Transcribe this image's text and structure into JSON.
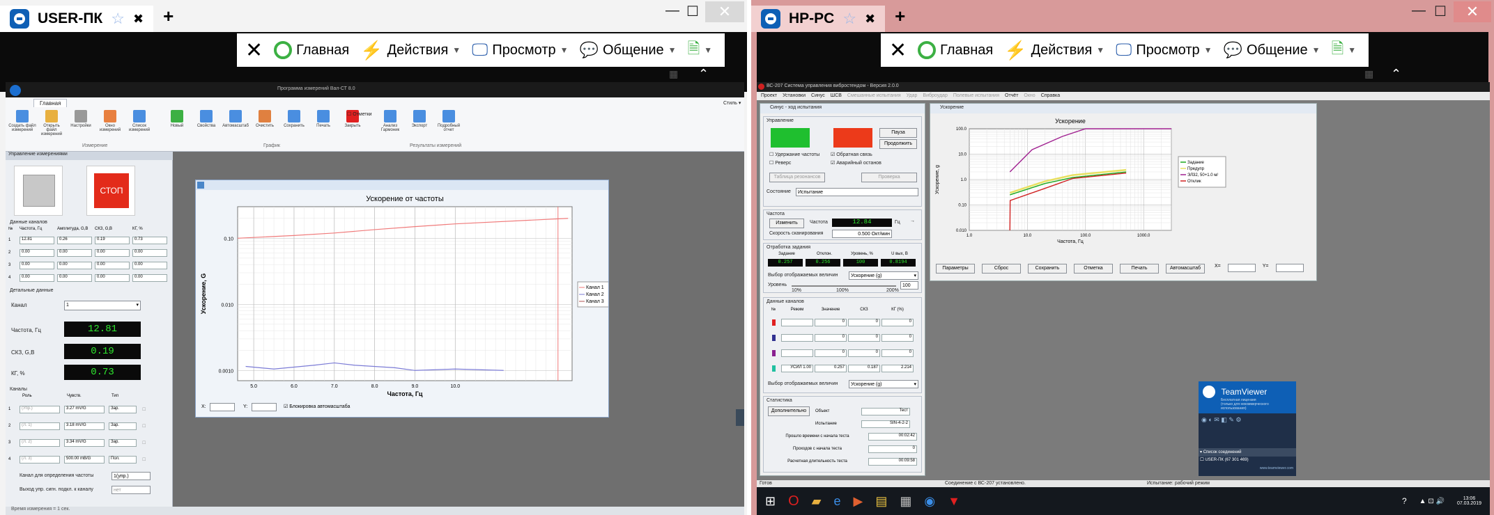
{
  "left": {
    "tab_title": "USER-ПК",
    "toolbar": {
      "home": "Главная",
      "actions": "Действия",
      "view": "Просмотр",
      "comm": "Общение"
    },
    "app": {
      "title": "Программа измерений Вал-СТ 8.0",
      "ribbon_tab": "Главная",
      "style_label": "Стиль ▾",
      "buttons": [
        "Создать файл измерений",
        "Открыть файл измерений",
        "Настройки",
        "Окно измерений",
        "Список измерений",
        "Новый",
        "Свойства",
        "Автомасштаб",
        "Очистить",
        "Сохранить",
        "Печать",
        "Закрыть",
        "Анализ Гармоник",
        "Экспорт",
        "Подробный отчет"
      ],
      "checkbox_marks": "Отметки",
      "groups": [
        "Измерение",
        "График",
        "Результаты измерений"
      ],
      "panel_header": "Управление измерениями",
      "stop_label": "СТОП",
      "channel_data_label": "Данные каналов",
      "cols": [
        "№",
        "Частота, Гц",
        "Амплитуда, G,B",
        "СКЗ, G,B",
        "КГ, %"
      ],
      "rows": [
        [
          "1",
          "12.81",
          "0.26",
          "0.19",
          "0.73"
        ],
        [
          "2",
          "0.00",
          "0.00",
          "0.00",
          "0.00"
        ],
        [
          "3",
          "0.00",
          "0.00",
          "0.00",
          "0.00"
        ],
        [
          "4",
          "0.00",
          "0.00",
          "0.00",
          "0.00"
        ]
      ],
      "detail_label": "Детальные данные",
      "channel_label": "Канал",
      "channel_value": "1",
      "freq_label": "Частота, Гц",
      "freq_value": "12.81",
      "rms_label": "СКЗ, G,B",
      "rms_value": "0.19",
      "kg_label": "КГ, %",
      "kg_value": "0.73",
      "channels_label": "Каналы",
      "ch_cols": [
        "Роль",
        "Чувств.",
        "Тип"
      ],
      "ch_rows": [
        [
          "1",
          "(Упр.)",
          "3.27 mV/G",
          "Зар."
        ],
        [
          "2",
          "(Л. 1)",
          "3.18 mV/G",
          "Зар."
        ],
        [
          "3",
          "(Л. 2)",
          "3.34 mV/G",
          "Зар."
        ],
        [
          "4",
          "(Л. 3)",
          "500.00 mB/G",
          "Пол."
        ]
      ],
      "freq_channel_label": "Канал для определения частоты",
      "freq_channel_value": "1(упр.)",
      "output_label": "Выход упр. сигн. подкл. к каналу",
      "output_value": "нет",
      "status": "Время измерения = 1 сек."
    },
    "chart_data": {
      "type": "line",
      "title": "Ускорение от частоты",
      "xlabel": "Частота, Гц",
      "ylabel": "Ускорение, G",
      "x_ticks": [
        "5.0",
        "6.0",
        "7.0",
        "8.0",
        "9.0",
        "10.0"
      ],
      "y_ticks": [
        "0.10",
        "0.010",
        "0.0010"
      ],
      "xlim": [
        4.6,
        12.9
      ],
      "ylog": true,
      "ylim": [
        0.0007,
        0.3
      ],
      "series": [
        {
          "name": "Канал 1",
          "color": "#f07a7a",
          "x": [
            4.6,
            6,
            7,
            8,
            9,
            10,
            12.8
          ],
          "y": [
            0.1,
            0.11,
            0.12,
            0.135,
            0.15,
            0.165,
            0.2
          ]
        },
        {
          "name": "Канал 2",
          "color": "#7b7bd6",
          "x": [
            4.8,
            5.5,
            6.5,
            7.0,
            7.5,
            8.5,
            9.0,
            10.0,
            11.2
          ],
          "y": [
            0.00115,
            0.00105,
            0.0012,
            0.0013,
            0.0012,
            0.0011,
            0.001,
            0.00105,
            0.001
          ]
        }
      ],
      "legend": [
        "Канал 1",
        "Канал 2",
        "Канал 3"
      ],
      "x_label_prefix": "X:",
      "y_label_prefix": "Y:",
      "autoscale_label": "Блокировка автомасштаба"
    }
  },
  "right": {
    "tab_title": "HP-PC",
    "toolbar": {
      "home": "Главная",
      "actions": "Действия",
      "view": "Просмотр",
      "comm": "Общение"
    },
    "app": {
      "title": "ВС-207 Система управления вибростендом - Версия 2.0.0",
      "menu": [
        "Проект",
        "Установки",
        "Синус",
        "ШСВ",
        "Смешанные испытания",
        "Удар",
        "Виброудар",
        "Полевые испытания",
        "Отчёт",
        "Окно",
        "Справка"
      ],
      "sinus_title": "Синус - ход испытания",
      "control_label": "Управление",
      "pause": "Пауза",
      "continue": "Продолжить",
      "chk1": "Удержание частоты",
      "chk2": "Обратная связь",
      "chk3": "Реверс",
      "chk4": "Аварийный останов",
      "table_btn": "Таблица резонансов",
      "check_btn": "Проверка",
      "state_label": "Состояние",
      "state_value": "Испытание",
      "freq_group": "Частота",
      "change_btn": "Изменить",
      "freq_label": "Частота",
      "freq_value": "12.84",
      "freq_unit": "Гц",
      "scan_label": "Скорость сканирования",
      "scan_value": "0.500 Окт/мин",
      "task_group": "Отработка задания",
      "task_cols": [
        "Задание",
        "Отклон.",
        "Уровень, %",
        "U вых, В"
      ],
      "task_values": [
        "0.257",
        "0.256",
        "100",
        "0.8194"
      ],
      "select_label": "Выбор отображаемых величин",
      "select_value": "Ускорение (g)",
      "level_label": "Уровень",
      "level_value": "100",
      "level_marks": [
        "10%",
        "100%",
        "200%"
      ],
      "channels_group": "Данные каналов",
      "ch_cols": [
        "№",
        "Режим",
        "Значение",
        "СКЗ",
        "КГ (%)"
      ],
      "ch_rows": [
        [
          "",
          "",
          "0",
          "0",
          "0"
        ],
        [
          "",
          "",
          "0",
          "0",
          "0"
        ],
        [
          "",
          "",
          "0",
          "0",
          "0"
        ],
        [
          "",
          "УСИЛ 1.00",
          "0.257",
          "0.187",
          "2.214"
        ]
      ],
      "ch_colors": [
        "#e02020",
        "#303090",
        "#8a2090",
        "#20c0a0"
      ],
      "select2_label": "Выбор отображаемых величин",
      "select2_value": "Ускорение (g)",
      "stats_group": "Статистика",
      "more_btn": "Дополнительно",
      "stats": [
        [
          "Объект",
          "Тест"
        ],
        [
          "Испытание",
          "SIN-4-2-2"
        ],
        [
          "Прошло времени с начала теста",
          "00:02:42"
        ],
        [
          "Проходов с начала теста",
          "0"
        ],
        [
          "Расчетная длительность теста",
          "00:09:58"
        ]
      ],
      "accel_title": "Ускорение",
      "accel_buttons": [
        "Параметры",
        "Сброс",
        "Сохранить",
        "Отметка",
        "Печать",
        "Автомасштаб"
      ],
      "x_prefix": "X=",
      "y_prefix": "Y=",
      "status_left": "Готов",
      "status_mid": "Соединение с ВС-207 установлено.",
      "status_right": "Испытание: рабочий режим"
    },
    "chart_data": {
      "type": "line",
      "title": "Ускорение",
      "xlabel": "Частота, Гц",
      "ylabel": "Ускорение, g",
      "x_ticks": [
        "1.0",
        "10.0",
        "100.0",
        "1000.0"
      ],
      "y_ticks": [
        "100.0",
        "10.0",
        "1.0",
        "0.10",
        "0.010"
      ],
      "xlog": true,
      "ylog": true,
      "xlim": [
        1,
        3000
      ],
      "ylim": [
        0.01,
        100
      ],
      "series": [
        {
          "name": "Задание",
          "color": "#1aa81a",
          "x": [
            5,
            20,
            60,
            500
          ],
          "y": [
            0.25,
            0.7,
            1.2,
            2
          ]
        },
        {
          "name": "Предупр",
          "color": "#e8e060",
          "x": [
            5,
            20,
            60,
            500
          ],
          "y": [
            0.3,
            0.85,
            1.5,
            2.4
          ]
        },
        {
          "name": "ЭЛ32, 50+1.0 м/",
          "color": "#a02090",
          "x": [
            5,
            12,
            40,
            100,
            3000
          ],
          "y": [
            2,
            15,
            50,
            100,
            100
          ]
        },
        {
          "name": "Отклик",
          "color": "#d02020",
          "x": [
            5,
            5.05,
            20,
            60,
            500
          ],
          "y": [
            0.01,
            0.15,
            0.45,
            1.1,
            1.8
          ]
        }
      ],
      "legend": [
        "Задание",
        "Предупр",
        "ЭЛ32, 50+1.0 м/",
        "Отклик"
      ]
    },
    "teamviewer": {
      "title": "TeamViewer",
      "sub1": "Бесплатная лицензия",
      "sub2": "(только для некоммерческого использования)",
      "list_label": "Список соединений",
      "item": "USER-ПК (67 301 469)",
      "link": "www.teamviewer.com"
    },
    "clock": {
      "time": "13:06",
      "date": "07.03.2019"
    }
  }
}
